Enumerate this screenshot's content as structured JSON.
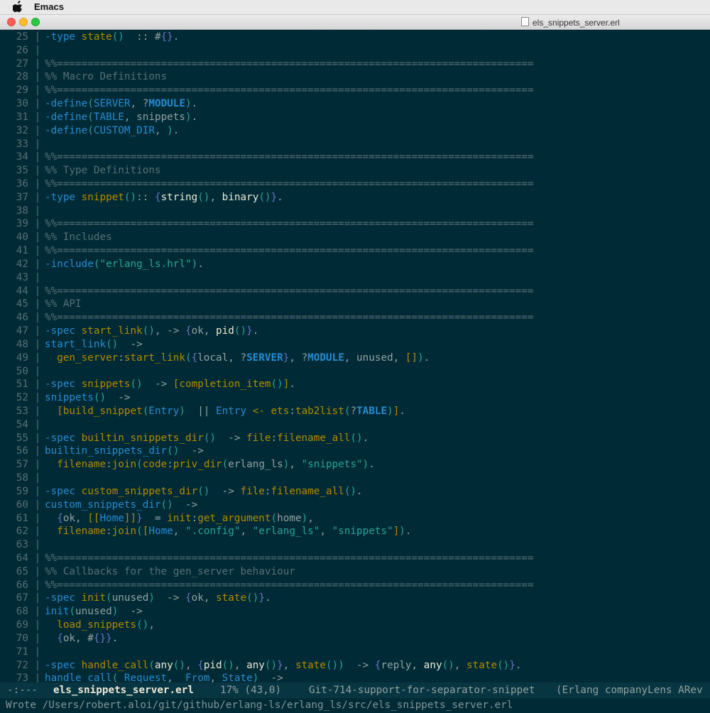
{
  "menubar": {
    "app_name": "Emacs"
  },
  "window": {
    "title": "els_snippets_server.erl"
  },
  "colors": {
    "background": "#002b36",
    "modeline_bg": "#073642",
    "linenumber": "#586e75",
    "comment": "#586e75",
    "keyword": "#268bd2",
    "function": "#b58900",
    "string": "#2aa198",
    "type": "#eee8d5",
    "default": "#93a1a1"
  },
  "editor": {
    "lines": [
      {
        "n": "25",
        "t": [
          [
            "kw",
            "-type "
          ],
          [
            "fn",
            "state"
          ],
          [
            "ar",
            "()"
          ],
          [
            "",
            "  :: #"
          ],
          [
            "ar-cb",
            "{}"
          ],
          [
            "",
            "."
          ]
        ]
      },
      {
        "n": "26",
        "t": []
      },
      {
        "n": "27",
        "t": [
          [
            "cm",
            "%%=============================================================================="
          ]
        ]
      },
      {
        "n": "28",
        "t": [
          [
            "cm",
            "%% Macro Definitions"
          ]
        ]
      },
      {
        "n": "29",
        "t": [
          [
            "cm",
            "%%=============================================================================="
          ]
        ]
      },
      {
        "n": "30",
        "t": [
          [
            "kw",
            "-define"
          ],
          [
            "ar",
            "("
          ],
          [
            "var",
            "SERVER"
          ],
          [
            "",
            ", ?"
          ],
          [
            "mac",
            "MODULE"
          ],
          [
            "ar",
            ")"
          ],
          [
            "",
            "."
          ]
        ]
      },
      {
        "n": "31",
        "t": [
          [
            "kw",
            "-define"
          ],
          [
            "ar",
            "("
          ],
          [
            "var",
            "TABLE"
          ],
          [
            "",
            ", snippets"
          ],
          [
            "ar",
            ")"
          ],
          [
            "",
            "."
          ]
        ]
      },
      {
        "n": "32",
        "t": [
          [
            "kw",
            "-define"
          ],
          [
            "ar",
            "("
          ],
          [
            "var",
            "CUSTOM_DIR"
          ],
          [
            "",
            ", "
          ],
          [
            "ar",
            ")"
          ],
          [
            "",
            "."
          ]
        ]
      },
      {
        "n": "33",
        "t": []
      },
      {
        "n": "34",
        "t": [
          [
            "cm",
            "%%=============================================================================="
          ]
        ]
      },
      {
        "n": "35",
        "t": [
          [
            "cm",
            "%% Type Definitions"
          ]
        ]
      },
      {
        "n": "36",
        "t": [
          [
            "cm",
            "%%=============================================================================="
          ]
        ]
      },
      {
        "n": "37",
        "t": [
          [
            "kw",
            "-type "
          ],
          [
            "fn",
            "snippet"
          ],
          [
            "ar",
            "()"
          ],
          [
            "",
            ":: "
          ],
          [
            "ar-cb",
            "{"
          ],
          [
            "ty",
            "string"
          ],
          [
            "ar",
            "()"
          ],
          [
            "",
            ", "
          ],
          [
            "ty",
            "binary"
          ],
          [
            "ar",
            "()"
          ],
          [
            "ar-cb",
            "}"
          ],
          [
            "",
            "."
          ]
        ]
      },
      {
        "n": "38",
        "t": []
      },
      {
        "n": "39",
        "t": [
          [
            "cm",
            "%%=============================================================================="
          ]
        ]
      },
      {
        "n": "40",
        "t": [
          [
            "cm",
            "%% Includes"
          ]
        ]
      },
      {
        "n": "41",
        "t": [
          [
            "cm",
            "%%=============================================================================="
          ]
        ]
      },
      {
        "n": "42",
        "t": [
          [
            "kw",
            "-include"
          ],
          [
            "ar",
            "("
          ],
          [
            "str",
            "\"erlang_ls.hrl\""
          ],
          [
            "ar",
            ")"
          ],
          [
            "",
            "."
          ]
        ]
      },
      {
        "n": "43",
        "t": []
      },
      {
        "n": "44",
        "t": [
          [
            "cm",
            "%%=============================================================================="
          ]
        ]
      },
      {
        "n": "45",
        "t": [
          [
            "cm",
            "%% API"
          ]
        ]
      },
      {
        "n": "46",
        "t": [
          [
            "cm",
            "%%=============================================================================="
          ]
        ]
      },
      {
        "n": "47",
        "t": [
          [
            "kw",
            "-spec "
          ],
          [
            "fn",
            "start_link"
          ],
          [
            "ar",
            "()"
          ],
          [
            "",
            ", -> "
          ],
          [
            "ar-cb",
            "{"
          ],
          [
            "",
            "ok, "
          ],
          [
            "ty",
            "pid"
          ],
          [
            "ar",
            "()"
          ],
          [
            "ar-cb",
            "}"
          ],
          [
            "",
            "."
          ]
        ]
      },
      {
        "n": "48",
        "t": [
          [
            "kw",
            "start_link"
          ],
          [
            "ar",
            "()"
          ],
          [
            "",
            "  ->"
          ]
        ]
      },
      {
        "n": "49",
        "t": [
          [
            "",
            "  "
          ],
          [
            "fn",
            "gen_server"
          ],
          [
            "",
            ":"
          ],
          [
            "fn",
            "start_link"
          ],
          [
            "ar",
            "("
          ],
          [
            "ar-cb",
            "{"
          ],
          [
            "",
            "local, ?"
          ],
          [
            "mac",
            "SERVER"
          ],
          [
            "ar-cb",
            "}"
          ],
          [
            "",
            ", ?"
          ],
          [
            "mac",
            "MODULE"
          ],
          [
            "",
            ", unused, "
          ],
          [
            "ar-sq",
            "[]"
          ],
          [
            "ar",
            ")"
          ],
          [
            "",
            "."
          ]
        ]
      },
      {
        "n": "50",
        "t": []
      },
      {
        "n": "51",
        "t": [
          [
            "kw",
            "-spec "
          ],
          [
            "fn",
            "snippets"
          ],
          [
            "ar",
            "()"
          ],
          [
            "",
            "  -> "
          ],
          [
            "ar-sq",
            "["
          ],
          [
            "fn",
            "completion_item"
          ],
          [
            "ar",
            "()"
          ],
          [
            "ar-sq",
            "]"
          ],
          [
            "",
            "."
          ]
        ]
      },
      {
        "n": "52",
        "t": [
          [
            "kw",
            "snippets"
          ],
          [
            "ar",
            "()"
          ],
          [
            "",
            "  ->"
          ]
        ]
      },
      {
        "n": "53",
        "t": [
          [
            "",
            "  "
          ],
          [
            "ar-sq",
            "["
          ],
          [
            "fn",
            "build_snippet"
          ],
          [
            "ar",
            "("
          ],
          [
            "var",
            "Entry"
          ],
          [
            "ar",
            ")"
          ],
          [
            "",
            "  || "
          ],
          [
            "var",
            "Entry"
          ],
          [
            "",
            ""
          ],
          [
            "fn",
            " <- "
          ],
          [
            "fn",
            "ets"
          ],
          [
            "",
            ":"
          ],
          [
            "fn",
            "tab2list"
          ],
          [
            "ar",
            "("
          ],
          [
            "",
            "?"
          ],
          [
            "mac",
            "TABLE"
          ],
          [
            "ar",
            ")"
          ],
          [
            "ar-sq",
            "]"
          ],
          [
            "",
            "."
          ]
        ]
      },
      {
        "n": "54",
        "t": []
      },
      {
        "n": "55",
        "t": [
          [
            "kw",
            "-spec "
          ],
          [
            "fn",
            "builtin_snippets_dir"
          ],
          [
            "ar",
            "()"
          ],
          [
            "",
            "  -> "
          ],
          [
            "fn",
            "file"
          ],
          [
            "",
            ":"
          ],
          [
            "fn",
            "filename_all"
          ],
          [
            "ar",
            "()"
          ],
          [
            "",
            "."
          ]
        ]
      },
      {
        "n": "56",
        "t": [
          [
            "kw",
            "builtin_snippets_dir"
          ],
          [
            "ar",
            "()"
          ],
          [
            "",
            "  ->"
          ]
        ]
      },
      {
        "n": "57",
        "t": [
          [
            "",
            "  "
          ],
          [
            "fn",
            "filename"
          ],
          [
            "",
            ":"
          ],
          [
            "fn",
            "join"
          ],
          [
            "ar",
            "("
          ],
          [
            "fn",
            "code"
          ],
          [
            "",
            ":"
          ],
          [
            "fn",
            "priv_dir"
          ],
          [
            "ar",
            "("
          ],
          [
            "",
            "erlang_ls"
          ],
          [
            "ar",
            ")"
          ],
          [
            "",
            ", "
          ],
          [
            "str",
            "\"snippets\""
          ],
          [
            "ar",
            ")"
          ],
          [
            "",
            "."
          ]
        ]
      },
      {
        "n": "58",
        "t": []
      },
      {
        "n": "59",
        "t": [
          [
            "kw",
            "-spec "
          ],
          [
            "fn",
            "custom_snippets_dir"
          ],
          [
            "ar",
            "()"
          ],
          [
            "",
            "  -> "
          ],
          [
            "fn",
            "file"
          ],
          [
            "",
            ":"
          ],
          [
            "fn",
            "filename_all"
          ],
          [
            "ar",
            "()"
          ],
          [
            "",
            "."
          ]
        ]
      },
      {
        "n": "60",
        "t": [
          [
            "kw",
            "custom_snippets_dir"
          ],
          [
            "ar",
            "()"
          ],
          [
            "",
            "  ->"
          ]
        ]
      },
      {
        "n": "61",
        "t": [
          [
            "",
            "  "
          ],
          [
            "ar-cb",
            "{"
          ],
          [
            "",
            "ok, "
          ],
          [
            "ar-sq",
            "[["
          ],
          [
            "var",
            "Home"
          ],
          [
            "ar-sq",
            "]]"
          ],
          [
            "ar-cb",
            "}"
          ],
          [
            "",
            "  = "
          ],
          [
            "fn",
            "init"
          ],
          [
            "",
            ":"
          ],
          [
            "fn",
            "get_argument"
          ],
          [
            "ar",
            "("
          ],
          [
            "",
            "home"
          ],
          [
            "ar",
            ")"
          ],
          [
            "",
            ","
          ]
        ]
      },
      {
        "n": "62",
        "t": [
          [
            "",
            "  "
          ],
          [
            "fn",
            "filename"
          ],
          [
            "",
            ":"
          ],
          [
            "fn",
            "join"
          ],
          [
            "ar",
            "("
          ],
          [
            "ar-sq",
            "["
          ],
          [
            "var",
            "Home"
          ],
          [
            "",
            ", "
          ],
          [
            "str",
            "\".config\""
          ],
          [
            "",
            ", "
          ],
          [
            "str",
            "\"erlang_ls\""
          ],
          [
            "",
            ", "
          ],
          [
            "str",
            "\"snippets\""
          ],
          [
            "ar-sq",
            "]"
          ],
          [
            "ar",
            ")"
          ],
          [
            "",
            "."
          ]
        ]
      },
      {
        "n": "63",
        "t": []
      },
      {
        "n": "64",
        "t": [
          [
            "cm",
            "%%=============================================================================="
          ]
        ]
      },
      {
        "n": "65",
        "t": [
          [
            "cm",
            "%% Callbacks for the gen_server behaviour"
          ]
        ]
      },
      {
        "n": "66",
        "t": [
          [
            "cm",
            "%%=============================================================================="
          ]
        ]
      },
      {
        "n": "67",
        "t": [
          [
            "kw",
            "-spec "
          ],
          [
            "fn",
            "init"
          ],
          [
            "ar",
            "("
          ],
          [
            "",
            "unused"
          ],
          [
            "ar",
            ")"
          ],
          [
            "",
            "  -> "
          ],
          [
            "ar-cb",
            "{"
          ],
          [
            "",
            "ok, "
          ],
          [
            "fn",
            "state"
          ],
          [
            "ar",
            "()"
          ],
          [
            "ar-cb",
            "}"
          ],
          [
            "",
            "."
          ]
        ]
      },
      {
        "n": "68",
        "t": [
          [
            "kw",
            "init"
          ],
          [
            "ar",
            "("
          ],
          [
            "",
            "unused"
          ],
          [
            "ar",
            ")"
          ],
          [
            "",
            "  ->"
          ]
        ]
      },
      {
        "n": "69",
        "t": [
          [
            "",
            "  "
          ],
          [
            "fn",
            "load_snippets"
          ],
          [
            "ar",
            "()"
          ],
          [
            "",
            ","
          ]
        ]
      },
      {
        "n": "70",
        "t": [
          [
            "",
            "  "
          ],
          [
            "ar-cb",
            "{"
          ],
          [
            "",
            "ok, #"
          ],
          [
            "ar-cb",
            "{}"
          ],
          [
            "ar-cb",
            "}"
          ],
          [
            "",
            "."
          ]
        ]
      },
      {
        "n": "71",
        "t": []
      },
      {
        "n": "72",
        "t": [
          [
            "kw",
            "-spec "
          ],
          [
            "fn",
            "handle_call"
          ],
          [
            "ar",
            "("
          ],
          [
            "ty",
            "any"
          ],
          [
            "ar",
            "()"
          ],
          [
            "",
            ", "
          ],
          [
            "ar-cb",
            "{"
          ],
          [
            "ty",
            "pid"
          ],
          [
            "ar",
            "()"
          ],
          [
            "",
            ", "
          ],
          [
            "ty",
            "any"
          ],
          [
            "ar",
            "()"
          ],
          [
            "ar-cb",
            "}"
          ],
          [
            "",
            ", "
          ],
          [
            "fn",
            "state"
          ],
          [
            "ar",
            "()"
          ],
          [
            "ar",
            ")"
          ],
          [
            "",
            "  -> "
          ],
          [
            "ar-cb",
            "{"
          ],
          [
            "",
            "reply, "
          ],
          [
            "ty",
            "any"
          ],
          [
            "ar",
            "()"
          ],
          [
            "",
            ", "
          ],
          [
            "fn",
            "state"
          ],
          [
            "ar",
            "()"
          ],
          [
            "ar-cb",
            "}"
          ],
          [
            "",
            "."
          ]
        ]
      },
      {
        "n": "73",
        "t": [
          [
            "kw",
            "handle_call"
          ],
          [
            "ar",
            "("
          ],
          [
            "var",
            "_Request"
          ],
          [
            "",
            ", "
          ],
          [
            "var",
            "_From"
          ],
          [
            "",
            ", "
          ],
          [
            "var",
            "State"
          ],
          [
            "ar",
            ")"
          ],
          [
            "",
            "  ->"
          ]
        ]
      }
    ]
  },
  "modeline": {
    "flags": "-:---",
    "buffer": "els_snippets_server.erl",
    "position": "17% (43,0)",
    "branch": "Git-714-support-for-separator-snippet",
    "modes": "(Erlang companyLens ARev"
  },
  "minibuffer": {
    "message": "Wrote /Users/robert.aloi/git/github/erlang-ls/erlang_ls/src/els_snippets_server.erl"
  }
}
